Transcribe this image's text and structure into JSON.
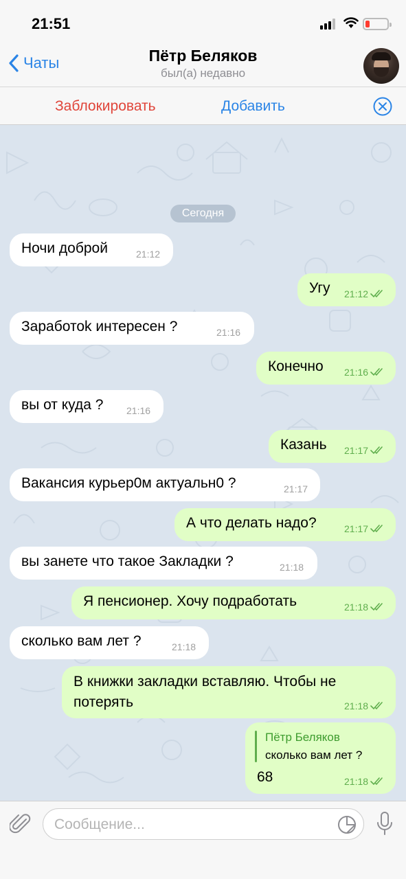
{
  "status": {
    "time": "21:51"
  },
  "header": {
    "back_label": "Чаты",
    "title": "Пётр Беляков",
    "subtitle": "был(а) недавно"
  },
  "actions": {
    "block_label": "Заблокировать",
    "add_label": "Добавить"
  },
  "chat": {
    "date_label": "Сегодня",
    "messages": [
      {
        "dir": "in",
        "text": "Ночи доброй",
        "time": "21:12"
      },
      {
        "dir": "out",
        "text": "Угу",
        "time": "21:12"
      },
      {
        "dir": "in",
        "text": "Заработоk интересен ?",
        "time": "21:16"
      },
      {
        "dir": "out",
        "text": "Конечно",
        "time": "21:16"
      },
      {
        "dir": "in",
        "text": "вы от куда ?",
        "time": "21:16"
      },
      {
        "dir": "out",
        "text": "Казань",
        "time": "21:17"
      },
      {
        "dir": "in",
        "text": "Вакансия курьер0м актуальн0 ?",
        "time": "21:17"
      },
      {
        "dir": "out",
        "text": "А что делать надо?",
        "time": "21:17"
      },
      {
        "dir": "in",
        "text": "вы занете что такое Закладки ?",
        "time": "21:18"
      },
      {
        "dir": "out",
        "text": "Я пенсионер. Хочу подработать",
        "time": "21:18"
      },
      {
        "dir": "in",
        "text": "сколько вам лет ?",
        "time": "21:18"
      },
      {
        "dir": "out",
        "text": "В книжки закладки вставляю. Чтобы не потерять",
        "time": "21:18"
      },
      {
        "dir": "out",
        "text": "68",
        "time": "21:18",
        "reply_name": "Пётр Беляков",
        "reply_text": "сколько вам лет ?"
      }
    ]
  },
  "input": {
    "placeholder": "Сообщение..."
  },
  "colors": {
    "accent": "#2a84e6",
    "danger": "#e0453a",
    "out_bubble": "#e1fec6",
    "in_bubble": "#ffffff",
    "chat_bg": "#dbe4ee",
    "read_check": "#5fae4d"
  }
}
